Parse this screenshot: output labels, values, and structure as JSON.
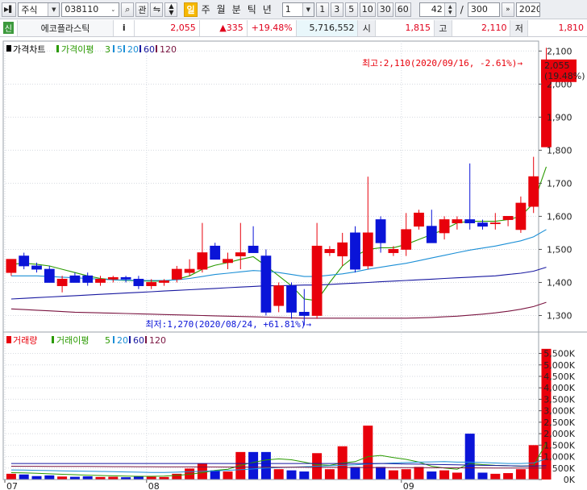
{
  "toolbar": {
    "market": "주식",
    "code": "038110",
    "btn_gwan": "관",
    "period_day": "일",
    "period_week": "주",
    "period_month": "월",
    "period_min": "분",
    "period_tick": "틱",
    "period_year": "년",
    "interval_value": "1",
    "quick": [
      "1",
      "3",
      "5",
      "10",
      "30",
      "60"
    ],
    "count_value": "42",
    "slash": "/",
    "total_value": "300",
    "date_value": "2020"
  },
  "info": {
    "credit_badge": "신",
    "stock_name": "에코플라스틱",
    "info_icon": "i",
    "price": "2,055",
    "change": "▲335",
    "change_pct": "+19.48%",
    "volume": "5,716,552",
    "open_label": "시",
    "open_value": "1,815",
    "high_label": "고",
    "high_value": "2,110",
    "low_label": "저",
    "low_value": "1,810"
  },
  "colors": {
    "up": "#e8000b",
    "down": "#0a14d8",
    "ma5": "#2a9a00",
    "ma20": "#1b8fd6",
    "ma60": "#1818a0",
    "ma120": "#7a1440",
    "grid": "#d6dae0"
  },
  "chart_data": [
    {
      "type": "candlestick",
      "legend": [
        {
          "label": "가격차트",
          "color": "#000000"
        },
        {
          "label": "가격이평",
          "color": "#2a9a00"
        },
        {
          "label": "3",
          "color": "#2a9a00"
        },
        {
          "label": "5",
          "color": "#1b8fd6"
        },
        {
          "label": "20",
          "color": "#1b8fd6"
        },
        {
          "label": "60",
          "color": "#1818a0"
        },
        {
          "label": "120",
          "color": "#7a1440"
        }
      ],
      "ylim": [
        1250,
        2130
      ],
      "yticks": [
        1300,
        1400,
        1500,
        1600,
        1700,
        1800,
        1900,
        2000,
        2100
      ],
      "ytick_labels": [
        "1,300",
        "1,400",
        "1,500",
        "1,600",
        "1,700",
        "1,800",
        "1,900",
        "2,000",
        "2,100"
      ],
      "current_price_label": "2,055",
      "current_pct_label": "(19.48%)",
      "max_annotation": "최고:2,110(2020/09/16, -2.61%)→",
      "min_annotation": "최저:1,270(2020/08/24, +61.81%)→",
      "x_labels": [
        {
          "index": 0,
          "label": "07"
        },
        {
          "index": 11,
          "label": "08"
        },
        {
          "index": 31,
          "label": "09"
        }
      ],
      "ohlc": [
        [
          1430,
          1470,
          1420,
          1470
        ],
        [
          1480,
          1490,
          1440,
          1450
        ],
        [
          1450,
          1460,
          1430,
          1440
        ],
        [
          1440,
          1450,
          1400,
          1400
        ],
        [
          1390,
          1420,
          1370,
          1410
        ],
        [
          1420,
          1430,
          1400,
          1400
        ],
        [
          1420,
          1430,
          1390,
          1400
        ],
        [
          1400,
          1420,
          1390,
          1410
        ],
        [
          1410,
          1420,
          1400,
          1415
        ],
        [
          1415,
          1420,
          1400,
          1410
        ],
        [
          1410,
          1420,
          1380,
          1390
        ],
        [
          1390,
          1410,
          1380,
          1400
        ],
        [
          1400,
          1410,
          1390,
          1405
        ],
        [
          1410,
          1450,
          1400,
          1440
        ],
        [
          1430,
          1470,
          1420,
          1440
        ],
        [
          1440,
          1580,
          1430,
          1490
        ],
        [
          1510,
          1520,
          1480,
          1470
        ],
        [
          1460,
          1490,
          1440,
          1470
        ],
        [
          1480,
          1580,
          1440,
          1490
        ],
        [
          1510,
          1570,
          1500,
          1490
        ],
        [
          1480,
          1500,
          1300,
          1310
        ],
        [
          1330,
          1400,
          1310,
          1390
        ],
        [
          1390,
          1400,
          1290,
          1310
        ],
        [
          1310,
          1380,
          1270,
          1300
        ],
        [
          1300,
          1580,
          1290,
          1510
        ],
        [
          1490,
          1510,
          1480,
          1500
        ],
        [
          1480,
          1550,
          1450,
          1520
        ],
        [
          1550,
          1570,
          1430,
          1440
        ],
        [
          1450,
          1720,
          1440,
          1550
        ],
        [
          1590,
          1600,
          1490,
          1520
        ],
        [
          1490,
          1510,
          1480,
          1500
        ],
        [
          1500,
          1610,
          1480,
          1560
        ],
        [
          1570,
          1620,
          1560,
          1610
        ],
        [
          1570,
          1620,
          1520,
          1520
        ],
        [
          1550,
          1600,
          1530,
          1590
        ],
        [
          1580,
          1600,
          1560,
          1590
        ],
        [
          1590,
          1760,
          1560,
          1580
        ],
        [
          1580,
          1590,
          1560,
          1570
        ],
        [
          1580,
          1610,
          1560,
          1580
        ],
        [
          1590,
          1600,
          1570,
          1600
        ],
        [
          1560,
          1660,
          1550,
          1640
        ],
        [
          1630,
          1780,
          1610,
          1720
        ],
        [
          1810,
          2110,
          1810,
          2055
        ]
      ],
      "ma5": [
        1455,
        1458,
        1455,
        1450,
        1440,
        1430,
        1420,
        1412,
        1408,
        1406,
        1405,
        1404,
        1404,
        1410,
        1420,
        1440,
        1452,
        1460,
        1470,
        1478,
        1450,
        1420,
        1390,
        1350,
        1345,
        1400,
        1450,
        1480,
        1500,
        1505,
        1505,
        1515,
        1530,
        1545,
        1560,
        1580,
        1585,
        1585,
        1585,
        1590,
        1600,
        1640,
        1750
      ],
      "ma20": [
        1420,
        1420,
        1420,
        1418,
        1416,
        1414,
        1412,
        1410,
        1408,
        1407,
        1406,
        1406,
        1406,
        1408,
        1412,
        1418,
        1424,
        1428,
        1432,
        1436,
        1434,
        1430,
        1424,
        1418,
        1418,
        1422,
        1426,
        1432,
        1440,
        1446,
        1452,
        1458,
        1466,
        1474,
        1482,
        1490,
        1498,
        1504,
        1510,
        1518,
        1526,
        1538,
        1560
      ],
      "ma60": [
        1350,
        1352,
        1354,
        1356,
        1358,
        1360,
        1362,
        1364,
        1366,
        1368,
        1370,
        1372,
        1374,
        1376,
        1378,
        1380,
        1382,
        1384,
        1386,
        1388,
        1390,
        1390,
        1391,
        1392,
        1392,
        1394,
        1396,
        1398,
        1400,
        1402,
        1404,
        1406,
        1408,
        1410,
        1412,
        1414,
        1416,
        1418,
        1420,
        1424,
        1428,
        1434,
        1446
      ],
      "ma120": [
        1320,
        1318,
        1316,
        1314,
        1312,
        1310,
        1309,
        1308,
        1307,
        1306,
        1305,
        1304,
        1303,
        1302,
        1301,
        1300,
        1299,
        1298,
        1297,
        1296,
        1295,
        1294,
        1293,
        1292,
        1292,
        1292,
        1292,
        1292,
        1292,
        1292,
        1292,
        1292,
        1293,
        1294,
        1296,
        1298,
        1301,
        1304,
        1308,
        1313,
        1319,
        1327,
        1340
      ]
    },
    {
      "type": "bar",
      "legend": [
        {
          "label": "거래량",
          "color": "#e8000b"
        },
        {
          "label": "거래이평",
          "color": "#2a9a00"
        },
        {
          "label": "5",
          "color": "#2a9a00"
        },
        {
          "label": "20",
          "color": "#1b8fd6"
        },
        {
          "label": "60",
          "color": "#1818a0"
        },
        {
          "label": "120",
          "color": "#7a1440"
        }
      ],
      "ylim": [
        0,
        5800000
      ],
      "yticks": [
        0,
        500000,
        1000000,
        1500000,
        2000000,
        2500000,
        3000000,
        3500000,
        4000000,
        4500000,
        5000000,
        5500000
      ],
      "ytick_labels": [
        "0K",
        "500K",
        "1,000K",
        "1,500K",
        "2,000K",
        "2,500K",
        "3,000K",
        "3,500K",
        "4,000K",
        "4,500K",
        "5,000K",
        "5,500K"
      ],
      "values": [
        250000,
        220000,
        150000,
        180000,
        130000,
        120000,
        140000,
        110000,
        120000,
        100000,
        130000,
        120000,
        110000,
        250000,
        480000,
        700000,
        400000,
        350000,
        1200000,
        1200000,
        1200000,
        450000,
        400000,
        350000,
        1150000,
        450000,
        1450000,
        550000,
        2350000,
        550000,
        400000,
        450000,
        550000,
        350000,
        400000,
        300000,
        2000000,
        300000,
        250000,
        280000,
        450000,
        1500000,
        5700000
      ],
      "vma5": [
        300000,
        290000,
        270000,
        250000,
        230000,
        210000,
        190000,
        175000,
        160000,
        150000,
        140000,
        140000,
        150000,
        180000,
        230000,
        300000,
        400000,
        450000,
        620000,
        750000,
        850000,
        900000,
        860000,
        760000,
        650000,
        620000,
        720000,
        780000,
        1000000,
        1050000,
        960000,
        880000,
        760000,
        580000,
        500000,
        450000,
        700000,
        650000,
        620000,
        600000,
        580000,
        600000,
        1600000
      ],
      "vma20": [
        420000,
        410000,
        400000,
        390000,
        380000,
        370000,
        360000,
        350000,
        340000,
        330000,
        320000,
        310000,
        310000,
        320000,
        340000,
        360000,
        380000,
        400000,
        430000,
        460000,
        500000,
        520000,
        540000,
        560000,
        580000,
        600000,
        620000,
        640000,
        680000,
        700000,
        720000,
        740000,
        760000,
        770000,
        780000,
        760000,
        760000,
        740000,
        720000,
        700000,
        700000,
        720000,
        900000
      ],
      "vma60": [
        700000,
        700000,
        700000,
        700000,
        700000,
        700000,
        700000,
        700000,
        700000,
        700000,
        700000,
        700000,
        700000,
        700000,
        700000,
        700000,
        700000,
        700000,
        700000,
        700000,
        700000,
        700000,
        700000,
        700000,
        700000,
        700000,
        700000,
        700000,
        700000,
        700000,
        690000,
        680000,
        670000,
        660000,
        650000,
        640000,
        630000,
        620000,
        610000,
        600000,
        590000,
        590000,
        600000
      ],
      "vma120": [
        580000,
        578000,
        576000,
        574000,
        572000,
        570000,
        568000,
        566000,
        564000,
        562000,
        560000,
        558000,
        556000,
        554000,
        552000,
        550000,
        548000,
        546000,
        544000,
        542000,
        540000,
        538000,
        536000,
        534000,
        532000,
        530000,
        528000,
        526000,
        524000,
        522000,
        520000,
        518000,
        516000,
        514000,
        512000,
        510000,
        508000,
        506000,
        504000,
        502000,
        500000,
        498000,
        500000
      ]
    }
  ]
}
